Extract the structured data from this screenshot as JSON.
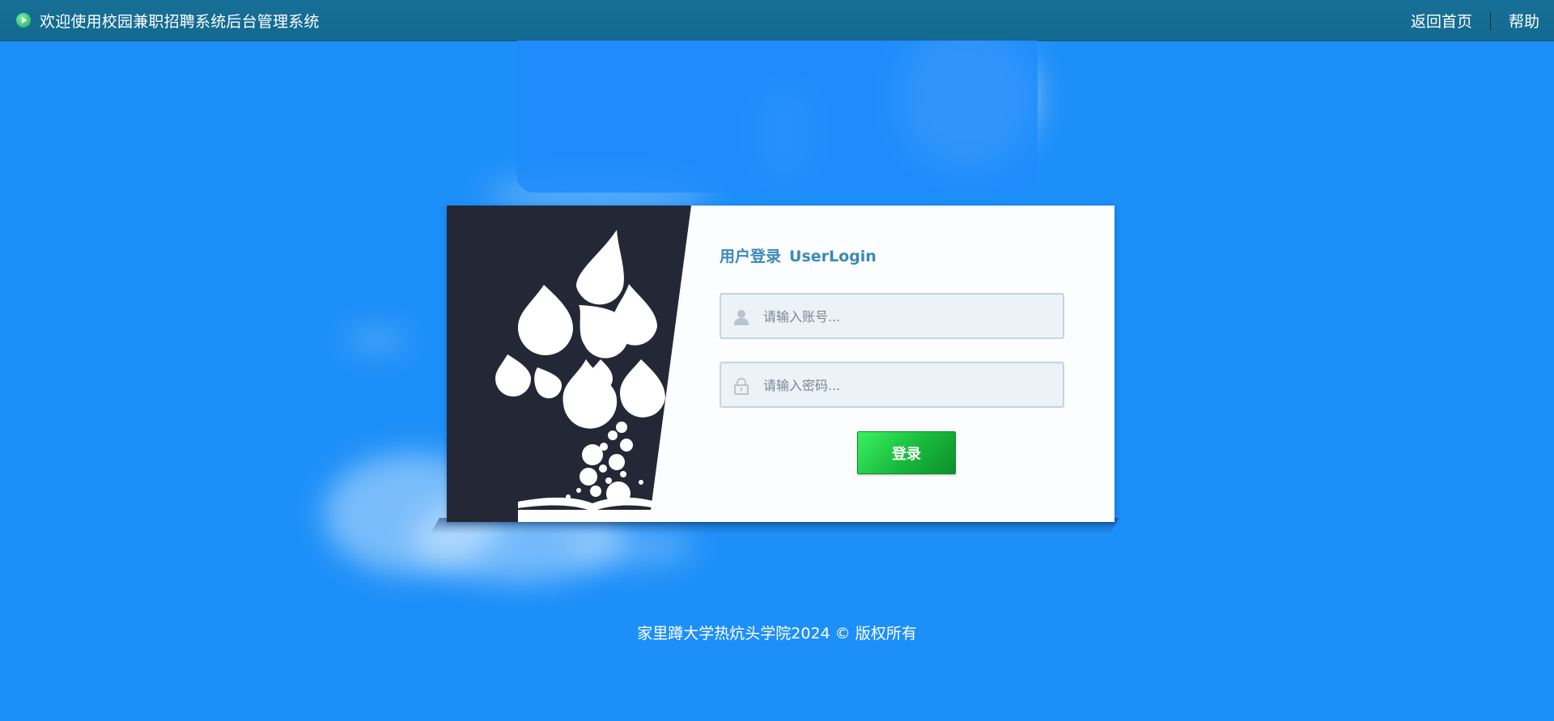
{
  "topbar": {
    "title": "欢迎使用校园兼职招聘系统后台管理系统",
    "home_link": "返回首页",
    "help_link": "帮助"
  },
  "login": {
    "title_cn": "用户登录",
    "title_en": "UserLogin",
    "account_placeholder": "请输入账号...",
    "password_placeholder": "请输入密码...",
    "submit_label": "登录"
  },
  "footer": {
    "copyright": "家里蹲大学热炕头学院2024 © 版权所有"
  },
  "colors": {
    "background": "#1d8ff8",
    "topbar": "#166f96",
    "accent_title": "#3b8ab8",
    "button_green": "#18b83d",
    "art_panel": "#242736"
  },
  "icons": {
    "logo": "play-circle-icon",
    "account": "user-icon",
    "password": "lock-icon",
    "illustration": "tree-of-drops-on-book"
  }
}
